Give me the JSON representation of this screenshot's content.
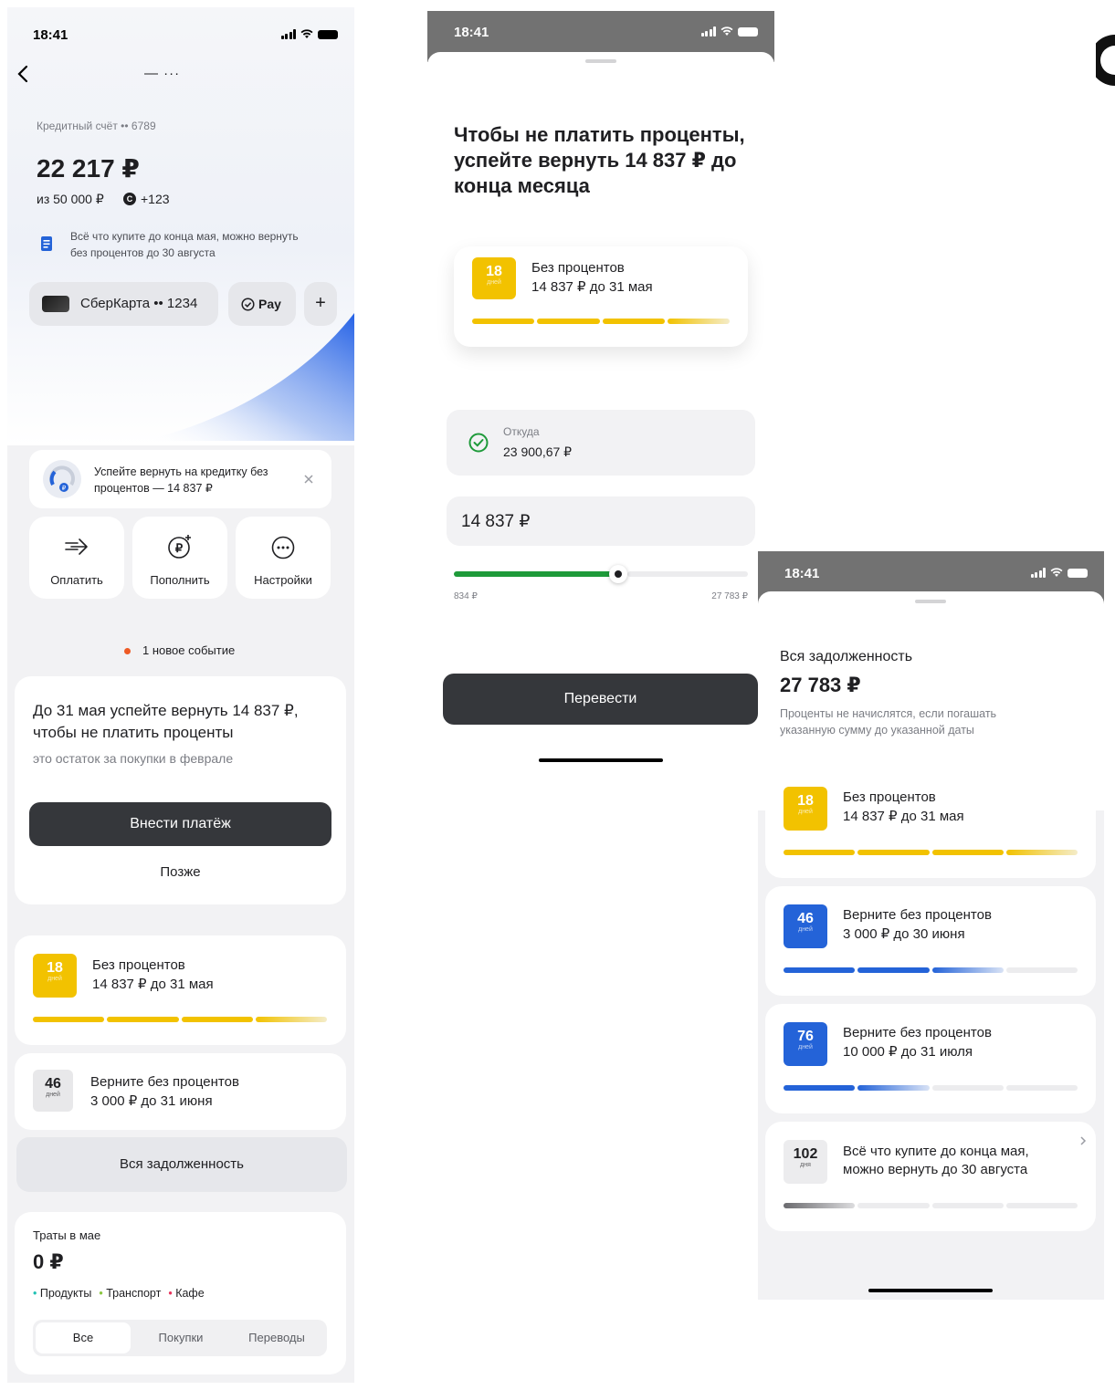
{
  "screen1": {
    "time": "18:41",
    "nav_title": "— ···",
    "account_label": "Кредитный счёт •• 6789",
    "balance": "22 217 ₽",
    "limit": "из 50 000 ₽",
    "bonus": "+123",
    "info_text": "Всё что купите до конца мая, можно вернуть без процентов до 30 августа",
    "card_label": "СберКарта •• 1234",
    "pay_label": "Pay",
    "add_label": "+",
    "reminder_text": "Успейте вернуть на кредитку без процентов — 14 837 ₽",
    "actions": [
      {
        "label": "Оплатить",
        "icon": "arrow-right-icon"
      },
      {
        "label": "Пополнить",
        "icon": "ruble-plus-icon"
      },
      {
        "label": "Настройки",
        "icon": "more-icon"
      }
    ],
    "event_text": "1 новое событие",
    "promo": {
      "title": "До 31 мая успейте вернуть 14 837 ₽, чтобы не платить проценты",
      "subtitle": "это остаток за покупки в феврале",
      "primary": "Внести платёж",
      "secondary": "Позже"
    },
    "gp1": {
      "days": "18",
      "unit": "дней",
      "title": "Без процентов",
      "subtitle": "14 837 ₽ до 31 мая"
    },
    "gp2": {
      "days": "46",
      "unit": "дней",
      "title": "Верните без процентов",
      "subtitle": "3 000 ₽ до 31 июня"
    },
    "all_debt": "Вся задолженность",
    "spend": {
      "title": "Траты в мае",
      "amount": "0 ₽",
      "categories": [
        {
          "name": "Продукты",
          "color": "#21c1b4"
        },
        {
          "name": "Транспорт",
          "color": "#8bc640"
        },
        {
          "name": "Кафе",
          "color": "#e8335b"
        }
      ],
      "tabs": [
        "Все",
        "Покупки",
        "Переводы"
      ]
    }
  },
  "screen2": {
    "time": "18:41",
    "heading": "Чтобы не платить проценты, успейте вернуть 14 837 ₽ до конца месяца",
    "gp": {
      "days": "18",
      "unit": "дней",
      "title": "Без процентов",
      "subtitle": "14 837 ₽ до 31 мая"
    },
    "from_label": "Откуда",
    "from_amount": "23 900,67 ₽",
    "amount": "14 837 ₽",
    "slider_min": "834 ₽",
    "slider_max": "27 783 ₽",
    "slider_value": 0.56,
    "button": "Перевести"
  },
  "screen3": {
    "time": "18:41",
    "title": "Вся задолженность",
    "amount": "27 783 ₽",
    "note": "Проценты не начислятся, если погашать указанную сумму до указанной даты",
    "items": [
      {
        "days": "18",
        "unit": "дней",
        "title": "Без процентов",
        "subtitle": "14 837 ₽ до 31 мая"
      },
      {
        "days": "46",
        "unit": "дней",
        "title": "Верните без процентов",
        "subtitle": "3 000 ₽ до 30 июня"
      },
      {
        "days": "76",
        "unit": "дней",
        "title": "Верните без процентов",
        "subtitle": "10 000 ₽ до 31 июля"
      },
      {
        "days": "102",
        "unit": "дня",
        "title": "Всё что купите до конца мая, можно вернуть до 30 августа",
        "subtitle": ""
      }
    ]
  },
  "colors": {
    "accent_gold": "#f2c200",
    "accent_blue": "#2463d8",
    "accent_green": "#1e9a3a",
    "dark_button": "#35373b"
  }
}
